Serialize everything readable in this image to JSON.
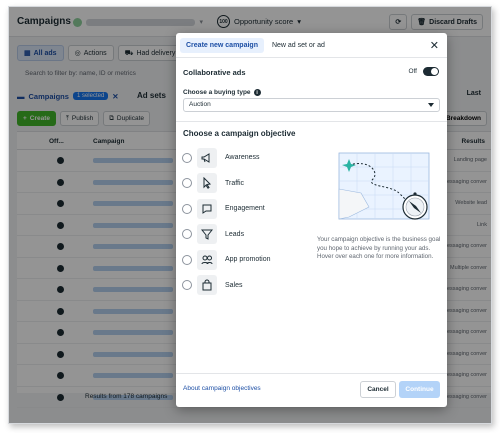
{
  "app": {
    "title": "Campaigns",
    "opportunity_label": "Opportunity score",
    "opportunity_value": "100",
    "discard_label": "Discard Drafts"
  },
  "toolbar_tabs": [
    {
      "label": "All ads"
    },
    {
      "label": "Actions"
    },
    {
      "label": "Had delivery"
    }
  ],
  "filter_placeholder": "Search to filter by: name, ID or metrics",
  "campaign_bar": {
    "campaigns_label": "Campaigns",
    "selected_label": "1 selected",
    "adsets_label": "Ad sets",
    "last_label": "Last"
  },
  "action_buttons": {
    "create": "Create",
    "publish": "Publish",
    "duplicate": "Duplicate",
    "breakdown": "Breakdown"
  },
  "table": {
    "col_off": "Off...",
    "col_campaign": "Campaign",
    "col_results": "Results",
    "rows": [
      {
        "result": "Landing page"
      },
      {
        "result": "Messaging conver"
      },
      {
        "result": "Website lead"
      },
      {
        "result": "Link"
      },
      {
        "result": "Messaging conver"
      },
      {
        "result": "Multiple conver"
      },
      {
        "result": "Messaging conver"
      },
      {
        "result": "Messaging conver"
      },
      {
        "result": "Messaging conver"
      },
      {
        "result": "Messaging conver"
      },
      {
        "result": "Messaging conver"
      },
      {
        "result": "Messaging conver"
      }
    ],
    "footer": "Results from 178 campaigns"
  },
  "modal": {
    "tab_new": "Create new campaign",
    "tab_existing": "New ad set or ad",
    "collab_label": "Collaborative ads",
    "collab_state": "Off",
    "buying_type_label": "Choose a buying type",
    "buying_type_value": "Auction",
    "objective_title": "Choose a campaign objective",
    "objectives": [
      {
        "label": "Awareness",
        "icon": "megaphone-icon"
      },
      {
        "label": "Traffic",
        "icon": "cursor-icon"
      },
      {
        "label": "Engagement",
        "icon": "chat-icon"
      },
      {
        "label": "Leads",
        "icon": "funnel-icon"
      },
      {
        "label": "App promotion",
        "icon": "people-icon"
      },
      {
        "label": "Sales",
        "icon": "shopping-bag-icon"
      }
    ],
    "description": "Your campaign objective is the business goal you hope to achieve by running your ads. Hover over each one for more information.",
    "about_link": "About campaign objectives",
    "cancel": "Cancel",
    "continue": "Continue"
  },
  "colors": {
    "accent": "#1877f2",
    "create_green": "#42b72a",
    "continue_disabled": "#b3d3f8"
  }
}
